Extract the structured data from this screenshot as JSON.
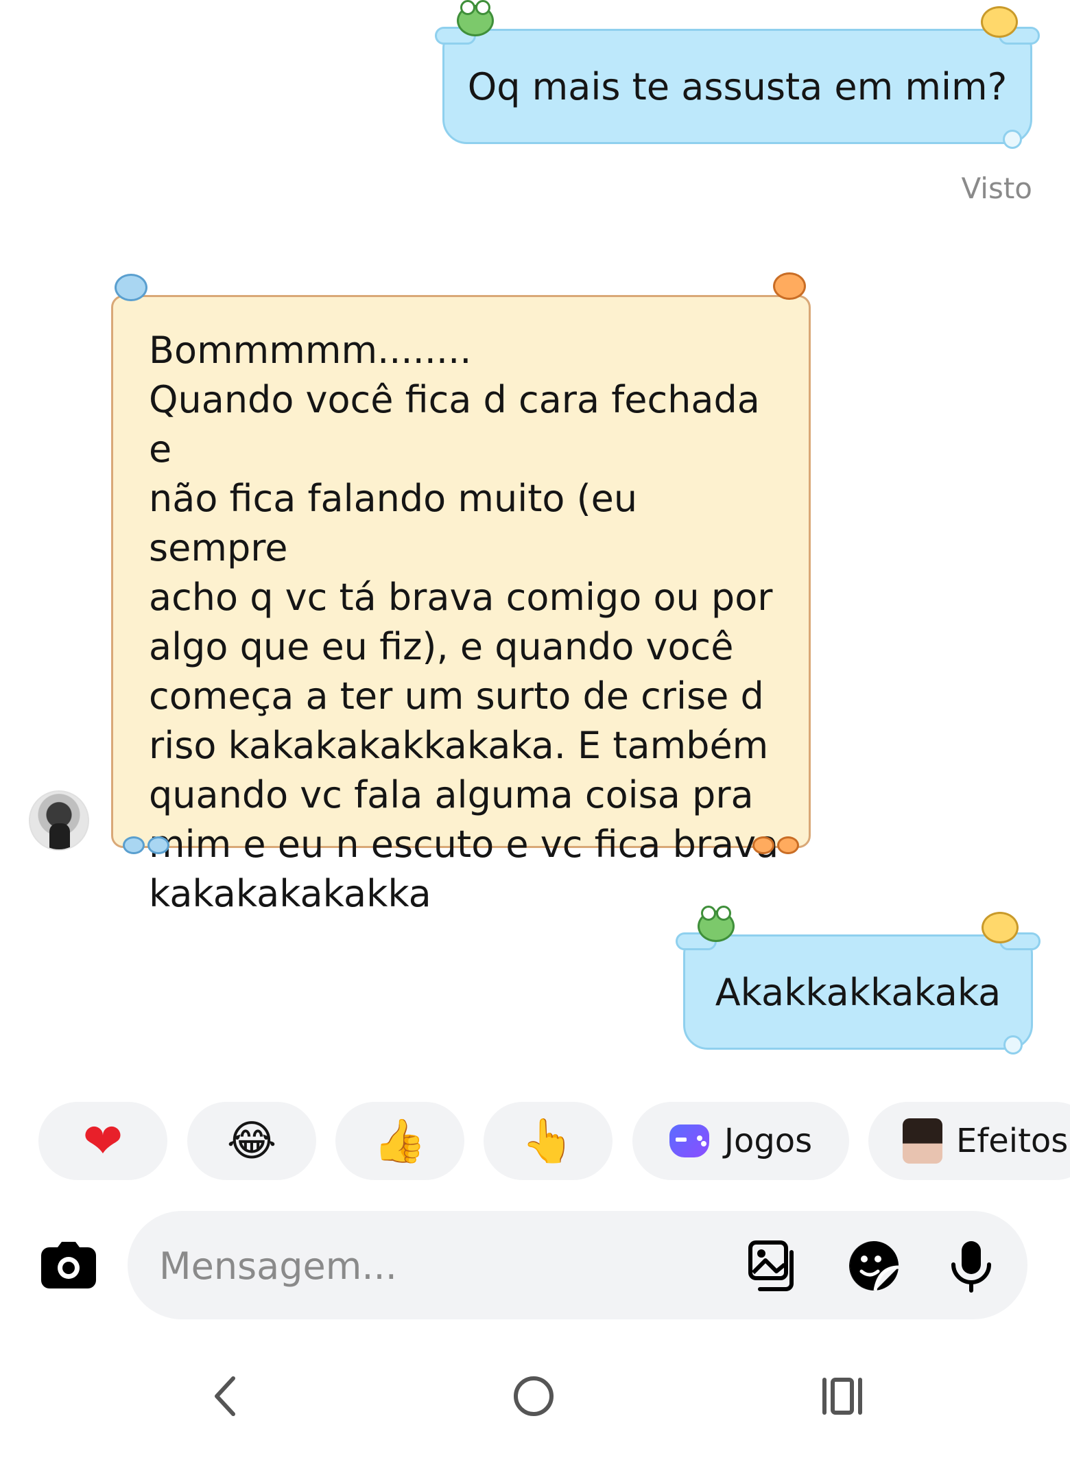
{
  "messages": [
    {
      "direction": "outgoing",
      "text": "Oq mais te assusta em mim?"
    },
    {
      "direction": "incoming",
      "text": "Bommmmm........\nQuando você fica d cara fechada e\nnão fica falando muito (eu sempre\nacho q vc tá brava comigo ou por\nalgo que eu fiz), e quando você\ncomeça a ter um surto de crise d\nriso kakakakakkakaka. E também\nquando vc fala alguma coisa pra\nmim e eu n escuto e vc fica brava\nkakakakakakka"
    },
    {
      "direction": "outgoing",
      "text": "Akakkakkakaka"
    }
  ],
  "seen_label": "Visto",
  "quick_actions": {
    "heart": "❤",
    "laugh": "😂",
    "thumbs_up": "👍",
    "point": "👆",
    "games_label": "Jogos",
    "effects_label": "Efeitos"
  },
  "composer": {
    "placeholder": "Mensagem..."
  },
  "colors": {
    "outgoing_bubble": "#bde8fb",
    "incoming_bubble": "#fdf1cf",
    "chip_background": "#f2f3f5",
    "heart": "#e8202a"
  },
  "icons": {
    "camera": "camera-icon",
    "gallery": "gallery-icon",
    "sticker": "sticker-icon",
    "microphone": "microphone-icon",
    "back": "back-icon",
    "home": "home-icon",
    "recents": "recents-icon"
  }
}
